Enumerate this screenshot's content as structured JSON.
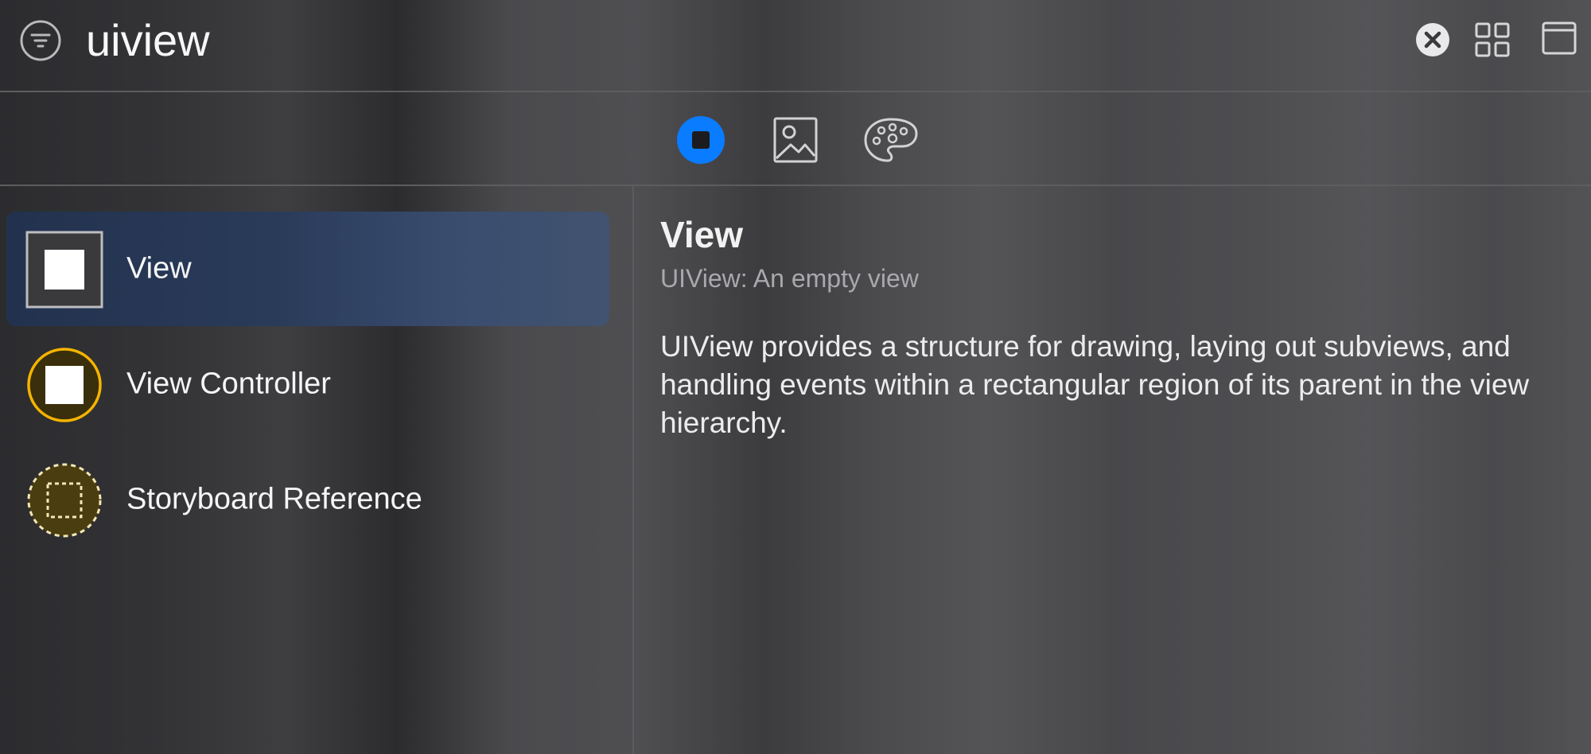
{
  "search": {
    "value": "uiview",
    "filter_icon": "filter-lines-icon",
    "clear_icon": "clear-circle-x-icon"
  },
  "header_buttons": {
    "grid_icon": "grid-view-icon",
    "window_icon": "window-panel-icon"
  },
  "library_tabs": [
    {
      "icon": "objects-library-icon",
      "selected": true
    },
    {
      "icon": "image-library-icon",
      "selected": false
    },
    {
      "icon": "color-palette-icon",
      "selected": false
    }
  ],
  "library_items": [
    {
      "label": "View",
      "icon": "view-square-icon",
      "selected": true
    },
    {
      "label": "View Controller",
      "icon": "view-controller-icon",
      "selected": false
    },
    {
      "label": "Storyboard Reference",
      "icon": "storyboard-reference-icon",
      "selected": false
    }
  ],
  "detail": {
    "title": "View",
    "subtitle": "UIView: An empty view",
    "description": "UIView provides a structure for drawing, laying out subviews, and handling events within a rectangular region of its parent in the view hierarchy."
  },
  "colors": {
    "accent": "#0a7cff",
    "selection": "#2a3b5a",
    "controller_yellow": "#f5b400",
    "reference_dark": "#4a3d10"
  }
}
